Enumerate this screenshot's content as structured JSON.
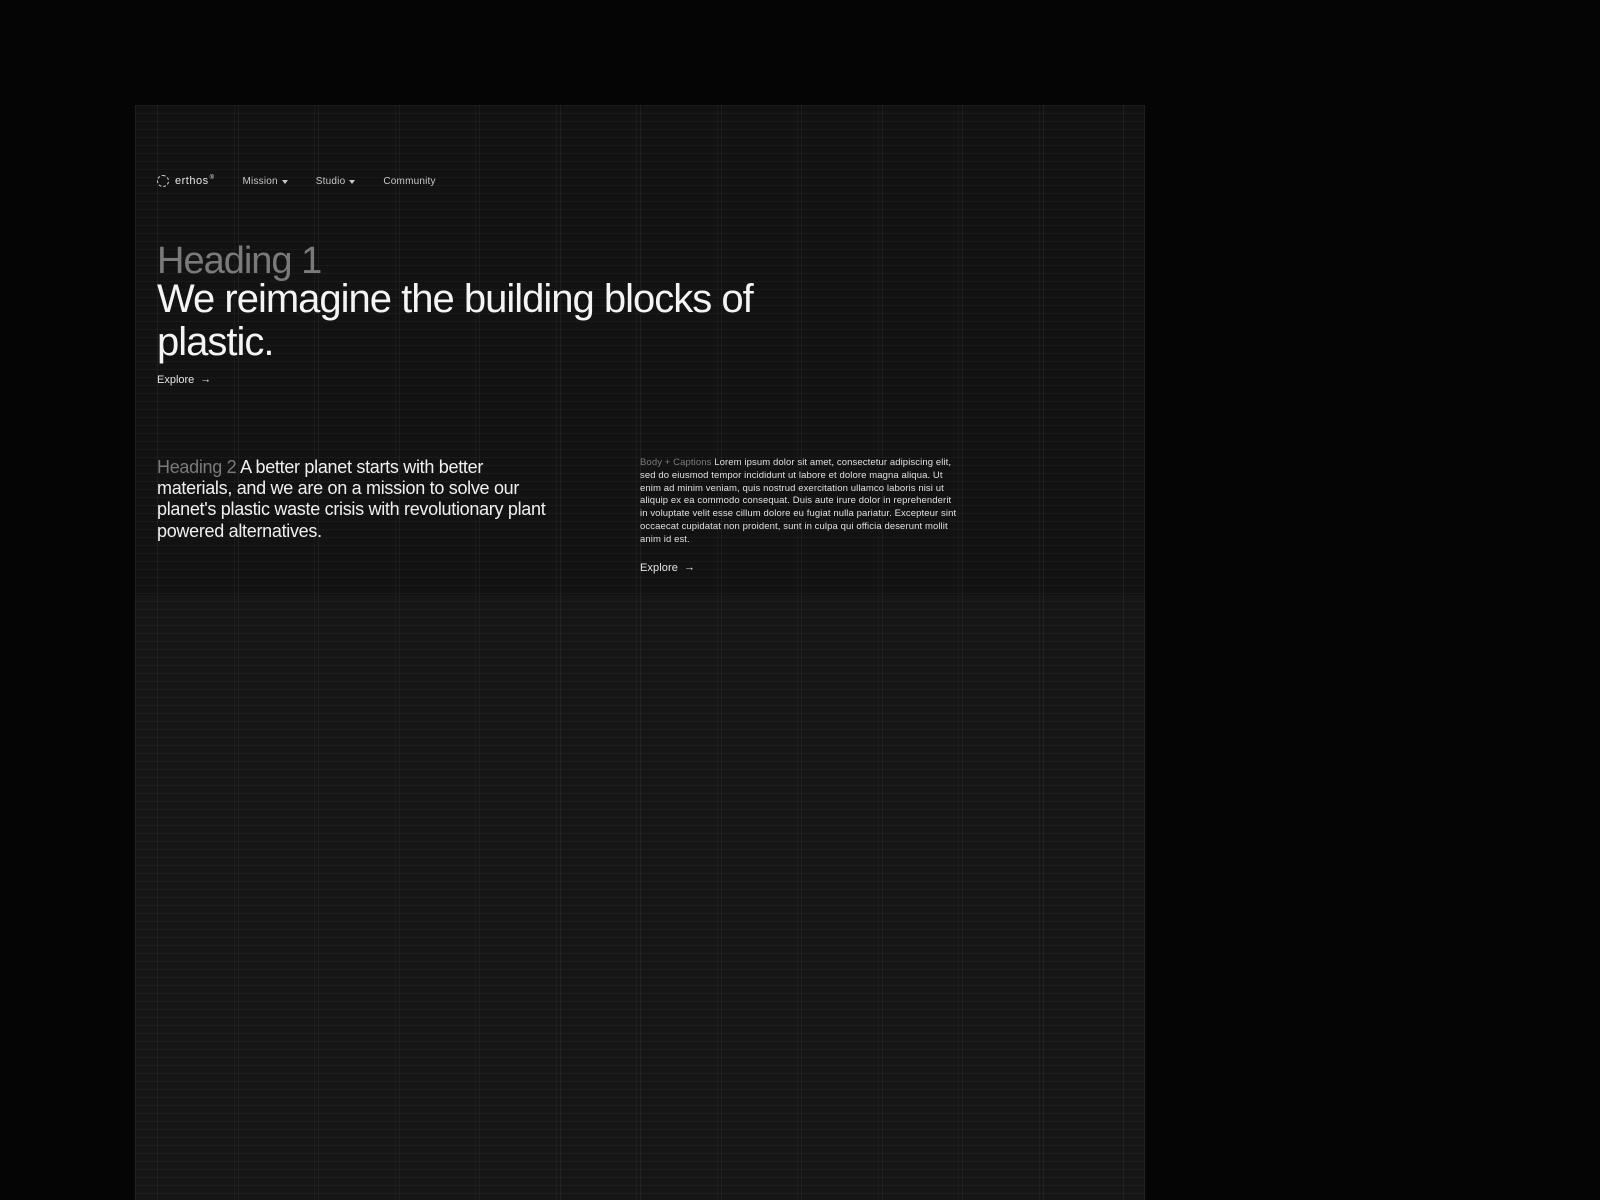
{
  "brand": {
    "name": "erthos",
    "mark_suffix": "®"
  },
  "nav": {
    "items": [
      {
        "label": "Mission",
        "has_dropdown": true
      },
      {
        "label": "Studio",
        "has_dropdown": true
      },
      {
        "label": "Community",
        "has_dropdown": false
      }
    ]
  },
  "hero": {
    "h1_label": "Heading 1",
    "h1_text": "We reimagine the building blocks of plastic.",
    "explore_label": "Explore"
  },
  "section2": {
    "h2_label": "Heading 2",
    "h2_text": "A better planet starts with better materials, and we are on a mission to solve our planet's plastic waste crisis with revolutionary plant powered alternatives."
  },
  "body": {
    "label": "Body + Captions",
    "text": "Lorem ipsum dolor sit amet, consectetur adipiscing elit, sed do eiusmod tempor incididunt ut labore et dolore magna aliqua. Ut enim ad minim veniam, quis nostrud exercitation ullamco laboris nisi ut aliquip ex ea commodo consequat. Duis aute irure dolor in reprehenderit in voluptate velit esse cillum dolore eu fugiat nulla pariatur. Excepteur sint occaecat cupidatat non proident, sunt in culpa qui officia deserunt mollit anim id est.",
    "explore_label": "Explore"
  }
}
